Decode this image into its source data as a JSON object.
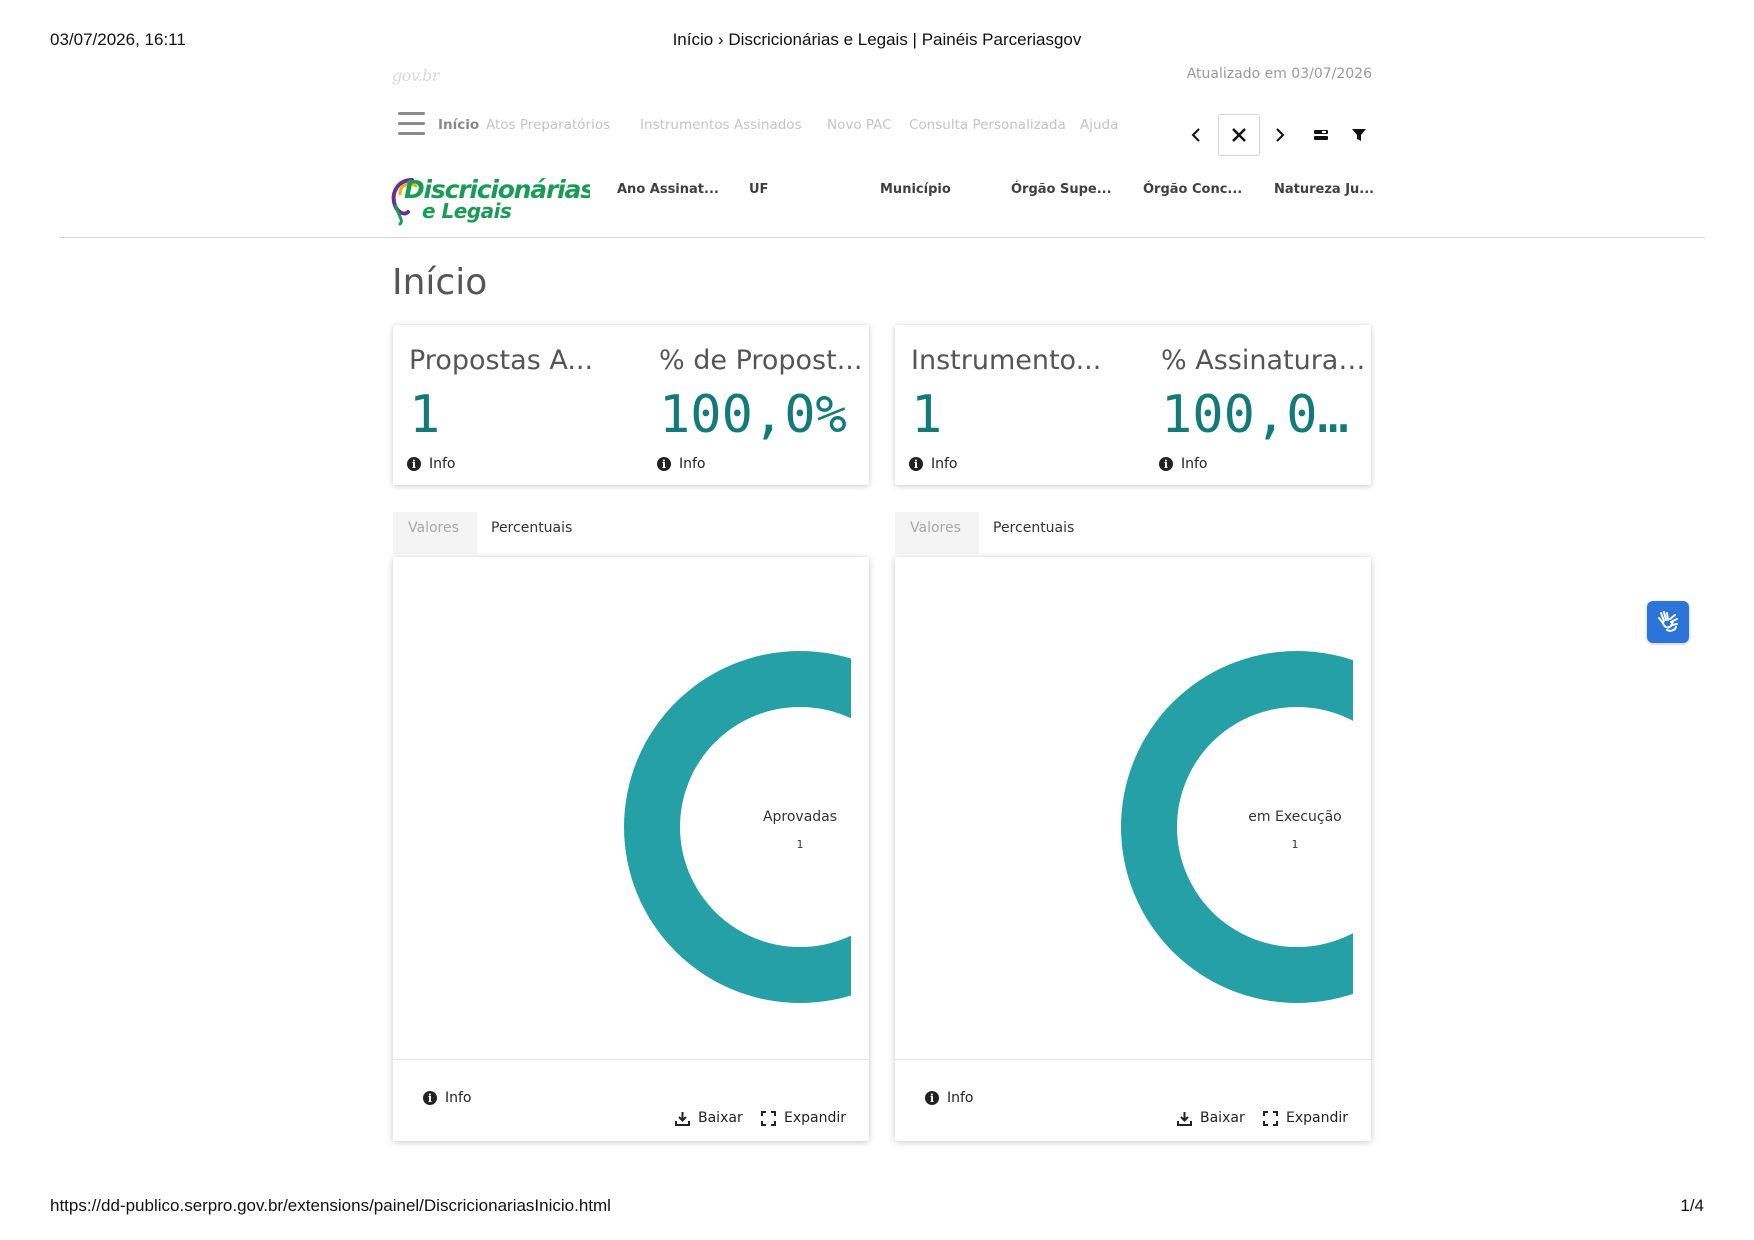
{
  "print": {
    "datetime": "03/07/2026, 16:11",
    "page_title": "Início › Discricionárias e Legais | Painéis Parceriasgov",
    "url": "https://dd-publico.serpro.gov.br/extensions/painel/DiscricionariasInicio.html",
    "page_number": "1/4"
  },
  "header": {
    "gov_logo_text": "gov.br",
    "updated": "Atualizado em 03/07/2026"
  },
  "nav": {
    "items": [
      {
        "label": "Início",
        "active": true
      },
      {
        "label": "Atos Preparatórios",
        "active": false
      },
      {
        "label": "Instrumentos Assinados",
        "active": false
      },
      {
        "label": "Novo PAC",
        "active": false
      },
      {
        "label": "Consulta Personalizada",
        "active": false
      },
      {
        "label": "Ajuda",
        "active": false
      }
    ]
  },
  "brand": {
    "line1": "Discricionárias",
    "line2": "e Legais"
  },
  "filters": [
    "Ano Assinat...",
    "UF",
    "Município",
    "Órgão Supe...",
    "Órgão Conc...",
    "Natureza Ju..."
  ],
  "page_title": "Início",
  "kpi_cards": [
    {
      "kpis": [
        {
          "title": "Propostas A...",
          "value": "1",
          "info": "Info"
        },
        {
          "title": "% de Propost...",
          "value": "100,0%",
          "info": "Info"
        }
      ]
    },
    {
      "kpis": [
        {
          "title": "Instrumento...",
          "value": "1",
          "info": "Info"
        },
        {
          "title": "% Assinatura ...",
          "value": "100,0...",
          "info": "Info"
        }
      ]
    }
  ],
  "chart_panels": [
    {
      "tabs": [
        {
          "label": "Valores",
          "active": false
        },
        {
          "label": "Percentuais",
          "active": true
        }
      ],
      "info": "Info",
      "download": "Baixar",
      "expand": "Expandir"
    },
    {
      "tabs": [
        {
          "label": "Valores",
          "active": false
        },
        {
          "label": "Percentuais",
          "active": true
        }
      ],
      "info": "Info",
      "download": "Baixar",
      "expand": "Expandir"
    }
  ],
  "chart_data": [
    {
      "type": "pie",
      "categories": [
        "Aprovadas"
      ],
      "values": [
        1
      ],
      "color": "#26a0a7"
    },
    {
      "type": "pie",
      "categories": [
        "em Execução"
      ],
      "values": [
        1
      ],
      "color": "#26a0a7"
    }
  ],
  "colors": {
    "accent": "#137a7a",
    "donut": "#26a0a7",
    "brand_green": "#1a9c57",
    "brand_purple": "#6b2f8f",
    "a11y_button": "#2b74d8"
  }
}
